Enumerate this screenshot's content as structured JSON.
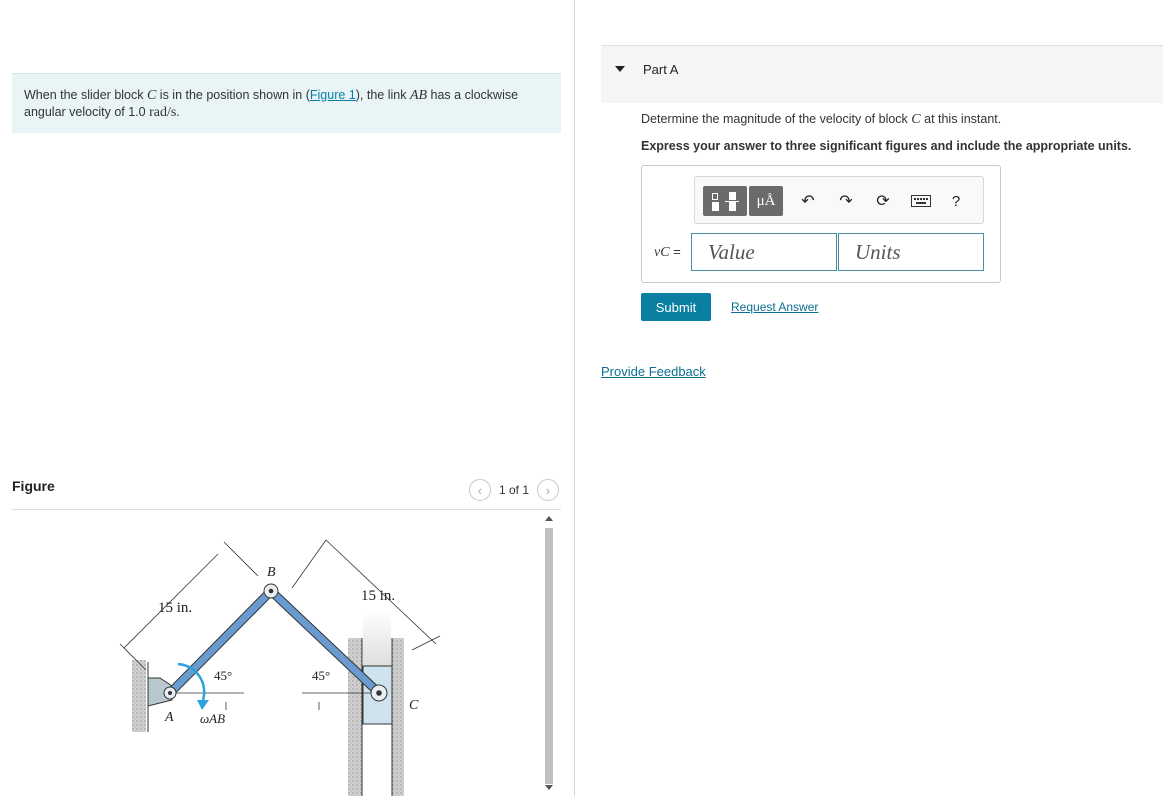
{
  "problem": {
    "text_1": "When the slider block ",
    "block_sym": "C",
    "text_2": " is in the position shown in (",
    "figure_link": "Figure 1",
    "text_3": "), the link ",
    "link_sym": "AB",
    "text_4": " has a clockwise angular velocity of 1.0 ",
    "unit": "rad/s",
    "text_5": "."
  },
  "figure": {
    "title": "Figure",
    "pager_text": "1 of 1",
    "prev_icon": "chevron-left-icon",
    "next_icon": "chevron-right-icon",
    "labels": {
      "left_length": "15 in.",
      "right_length": "15 in.",
      "point_a": "A",
      "point_b": "B",
      "point_c": "C",
      "angle_left": "45°",
      "angle_right": "45°",
      "omega": "ωAB"
    }
  },
  "part": {
    "title": "Part A",
    "question_1": "Determine the magnitude of the velocity of block ",
    "question_sym": "C",
    "question_2": " at this instant.",
    "instruction": "Express your answer to three significant figures and include the appropriate units."
  },
  "toolbar": {
    "units_label": "μÅ",
    "icons": [
      "templates-icon",
      "units-icon",
      "undo-icon",
      "redo-icon",
      "reset-icon",
      "keyboard-icon",
      "help-icon"
    ],
    "help_label": "?"
  },
  "answer": {
    "label_sym": "vC",
    "label_eq": " =",
    "value_placeholder": "Value",
    "units_placeholder": "Units"
  },
  "actions": {
    "submit_label": "Submit",
    "request_label": "Request Answer",
    "feedback_label": "Provide Feedback"
  },
  "colors": {
    "accent": "#0b7fa1",
    "problem_bg": "#e8f4f6",
    "link_blue": "#0a6f93",
    "rod_blue": "#5f8fc4",
    "omega_arrow": "#2aa3dc"
  }
}
